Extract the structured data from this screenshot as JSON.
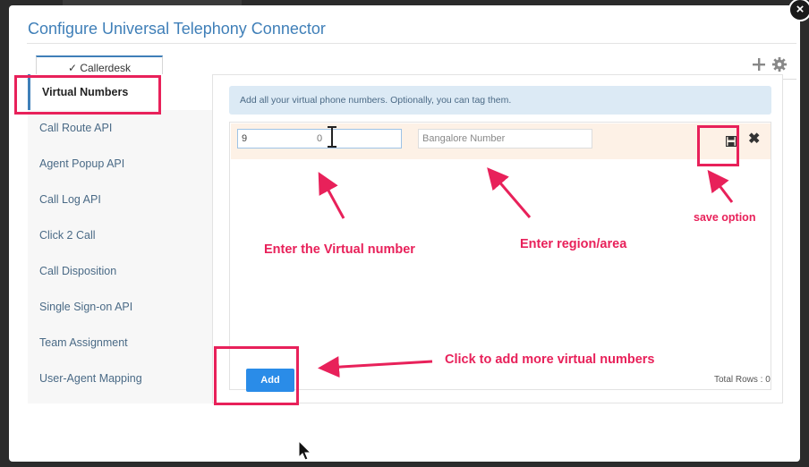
{
  "modal": {
    "title": "Configure Universal Telephony Connector",
    "close_glyph": "×"
  },
  "tab": {
    "label": "✓ Callerdesk"
  },
  "sidebar": {
    "items": [
      {
        "label": "Virtual Numbers",
        "active": true
      },
      {
        "label": "Call Route API"
      },
      {
        "label": "Agent Popup API"
      },
      {
        "label": "Call Log API"
      },
      {
        "label": "Click 2 Call"
      },
      {
        "label": "Call Disposition"
      },
      {
        "label": "Single Sign-on API"
      },
      {
        "label": "Team Assignment"
      },
      {
        "label": "User-Agent Mapping"
      }
    ]
  },
  "main": {
    "info_text": "Add all your virtual phone numbers. Optionally, you can tag them.",
    "edit_row": {
      "number_value": "9",
      "number_trailing": "0",
      "region_placeholder": "Bangalore Number"
    },
    "add_label": "Add",
    "total_rows": "Total Rows : 0"
  },
  "annotations": {
    "enter_number": "Enter the Virtual number",
    "enter_region": "Enter region/area",
    "save_option": "save option",
    "click_add": "Click to add more virtual numbers"
  },
  "colors": {
    "accent": "#3f7fb8",
    "highlight": "#e8215a",
    "add_button": "#2a8ce8",
    "info_bar": "#dceaf5",
    "edit_row": "#fdf1e6"
  },
  "icons": [
    "close-icon",
    "check-icon",
    "plus-icon",
    "gear-icon",
    "save-icon",
    "remove-icon",
    "text-cursor-icon",
    "mouse-pointer-icon"
  ]
}
